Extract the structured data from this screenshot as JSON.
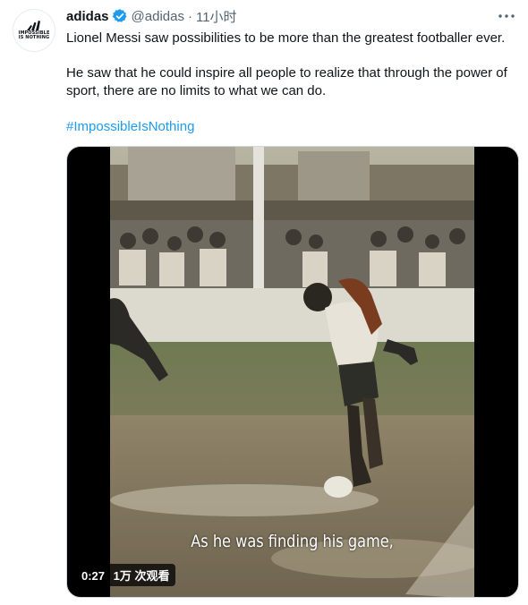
{
  "author": {
    "display_name": "adidas",
    "handle": "@adidas",
    "separator": "·",
    "timestamp": "11小时",
    "avatar_text_line1": "IMPOSSIBLE",
    "avatar_text_line2": "IS NOTHING",
    "verified_icon": "verified-badge-icon"
  },
  "tweet": {
    "paragraph1": "Lionel Messi saw possibilities to be more than the greatest footballer ever.",
    "paragraph2": "He saw that he could inspire all people to realize that through the power of sport, there are no limits to what we can do.",
    "hashtag": "#ImpossibleIsNothing"
  },
  "video": {
    "subtitle": "As he was finding his game,",
    "duration": "0:27",
    "views": "1万 次观看"
  },
  "colors": {
    "text": "#0f1419",
    "secondary": "#536471",
    "link": "#1d9bf0",
    "verified": "#1d9bf0"
  }
}
